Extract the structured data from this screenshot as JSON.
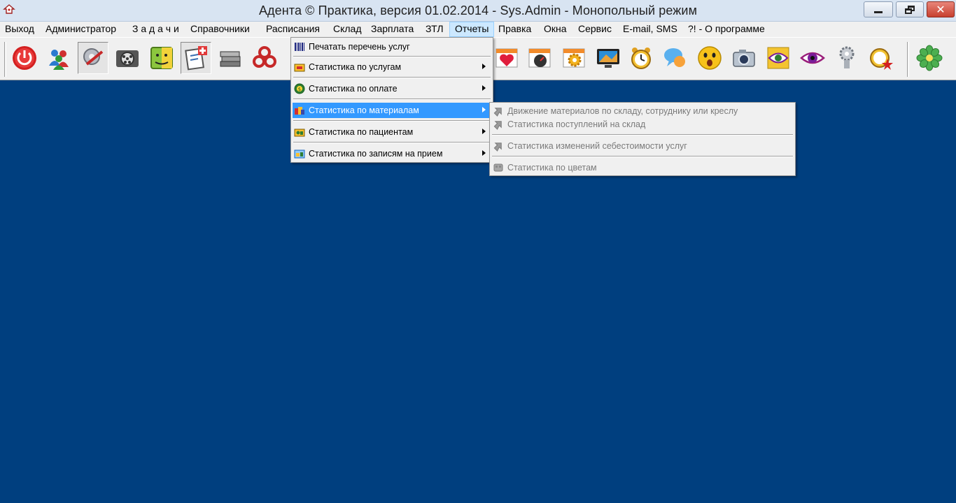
{
  "window": {
    "title": "Адента © Практика, версия 01.02.2014 - Sys.Admin - Монопольный режим",
    "app_icon": "adenta-tooth-icon",
    "controls": [
      "minimize-icon",
      "maximize-icon",
      "close-icon"
    ],
    "close_glyph": "✕"
  },
  "menubar": {
    "items": [
      {
        "label": "Выход"
      },
      {
        "label": "Администратор"
      },
      {
        "label": "З а д а ч и"
      },
      {
        "label": "Справочники"
      },
      {
        "label": "Расписания"
      },
      {
        "label": "Склад"
      },
      {
        "label": "Зарплата"
      },
      {
        "label": "ЗТЛ"
      },
      {
        "label": "Отчеты",
        "active": true
      },
      {
        "label": "Правка"
      },
      {
        "label": "Окна"
      },
      {
        "label": "Сервис"
      },
      {
        "label": "E-mail, SMS"
      },
      {
        "label": "?! - О программе"
      }
    ]
  },
  "toolbar": {
    "icons": [
      "power-icon",
      "users-icon",
      "tools-settings-icon",
      "film-reel-icon",
      "finder-face-icon",
      "medical-checklist-icon",
      "books-icon",
      "biohazard-icon",
      "hidden-icon",
      "calendar-heart-icon",
      "calendar-speedometer-icon",
      "calendar-gear-icon",
      "tv-monitor-icon",
      "alarm-clock-icon",
      "chat-bubbles-icon",
      "surprised-smiley-icon",
      "camera-icon",
      "eye-frame-icon",
      "eye-icon",
      "cog-figure-icon",
      "clock-star-icon",
      "icq-flower-icon"
    ]
  },
  "reports_menu": {
    "items": [
      {
        "label": "Печатать перечень услуг",
        "icon": "barcode-icon",
        "submenu": false
      },
      {
        "label": "Статистика по услугам",
        "icon": "services-stats-icon",
        "submenu": true
      },
      {
        "label": "Статистика по оплате",
        "icon": "payment-globe-icon",
        "submenu": true
      },
      {
        "label": "Статистика по материалам",
        "icon": "materials-stats-icon",
        "submenu": true,
        "highlighted": true
      },
      {
        "label": "Статистика по пациентам",
        "icon": "patients-stats-icon",
        "submenu": true
      },
      {
        "label": "Статистика по записям на прием",
        "icon": "appointments-stats-icon",
        "submenu": true
      }
    ]
  },
  "materials_submenu": {
    "items": [
      {
        "label": "Движение материалов по складу, сотруднику или креслу",
        "icon": "arrow-grey-icon",
        "disabled": true
      },
      {
        "label": "Статистика поступлений на склад",
        "icon": "arrow-grey-icon",
        "disabled": true
      },
      {
        "label": "Статистика изменений себестоимости услуг",
        "icon": "arrow-grey-icon",
        "disabled": true
      },
      {
        "label": "Статистика по цветам",
        "icon": "palette-grey-icon",
        "disabled": true
      }
    ]
  },
  "colors": {
    "desktop": "#003f7f",
    "highlight": "#3399ff",
    "menu_bg": "#f0f0f0",
    "active_menu": "#cce8ff"
  }
}
